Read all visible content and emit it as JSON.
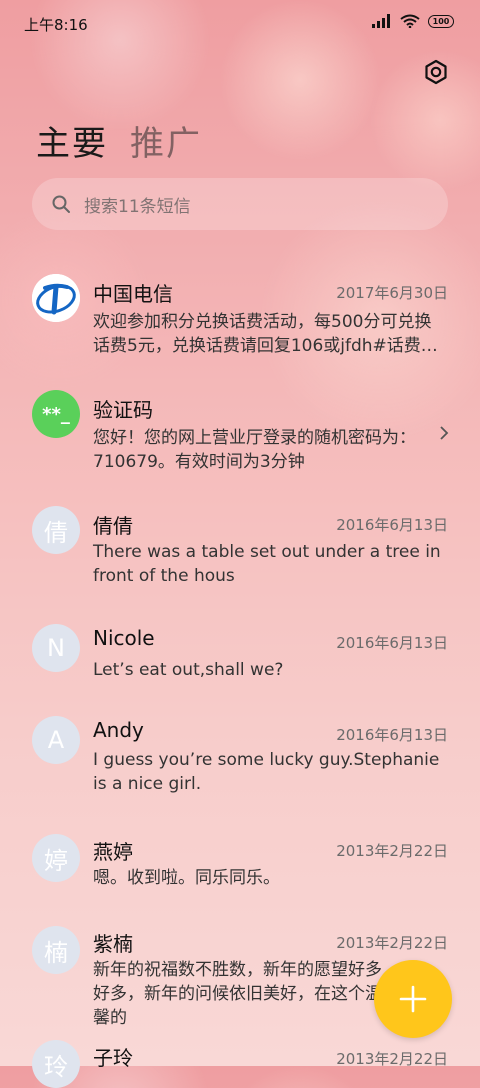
{
  "status": {
    "time": "上午8:16",
    "battery": "100"
  },
  "header": {
    "tabs": [
      {
        "label": "主要"
      },
      {
        "label": "推广"
      }
    ]
  },
  "search": {
    "placeholder": "搜索11条短信"
  },
  "conversations": [
    {
      "name": "中国电信",
      "date": "2017年6月30日",
      "preview": "欢迎参加积分兑换话费活动，每500分可兑换话费5元，兑换话费请回复106或jfdh#话费…",
      "avatar": "china-telecom-logo"
    },
    {
      "name": "验证码",
      "date": "",
      "preview": "您好！您的网上营业厅登录的随机密码为：710679。有效时间为3分钟",
      "avatar_text": "**_"
    },
    {
      "name": "倩倩",
      "date": "2016年6月13日",
      "preview": "There was a table set out under a tree in front of the hous",
      "avatar_text": "倩"
    },
    {
      "name": "Nicole",
      "date": "2016年6月13日",
      "preview": "Let’s eat out,shall we?",
      "avatar_text": "N"
    },
    {
      "name": "Andy",
      "date": "2016年6月13日",
      "preview": "I guess you’re some lucky guy.Stephanie is a nice girl.",
      "avatar_text": "A"
    },
    {
      "name": "燕婷",
      "date": "2013年2月22日",
      "preview": "嗯。收到啦。同乐同乐。",
      "avatar_text": "婷"
    },
    {
      "name": "紫楠",
      "date": "2013年2月22日",
      "preview": "新年的祝福数不胜数，新年的愿望好多好多，新年的问候依旧美好，在这个温馨的",
      "avatar_text": "楠"
    },
    {
      "name": "子玲",
      "date": "2013年2月22日",
      "preview": "",
      "avatar_text": "玲"
    }
  ],
  "colors": {
    "fab": "#ffc61b",
    "verify_avatar": "#5ad05a",
    "telecom_blue": "#1466c4"
  },
  "fab": {
    "icon": "plus-icon"
  }
}
